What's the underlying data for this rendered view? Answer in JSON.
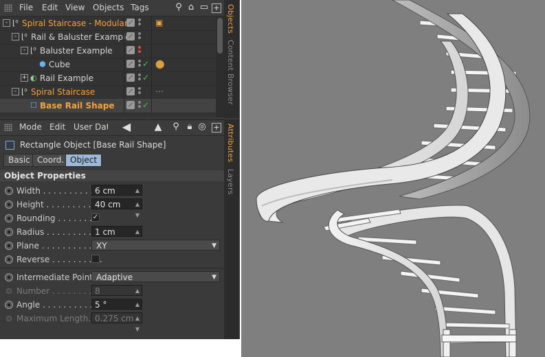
{
  "menu": [
    "File",
    "Edit",
    "View",
    "Objects",
    "Tags"
  ],
  "object_tree": [
    {
      "label": "Spiral Staircase - Modular",
      "color": "orange",
      "indent": 0,
      "expand": "-",
      "check": false
    },
    {
      "label": "Rail & Baluster Example",
      "color": "white",
      "indent": 1,
      "expand": "-",
      "check": false
    },
    {
      "label": "Baluster Example",
      "color": "white",
      "indent": 2,
      "expand": "-",
      "check": false
    },
    {
      "label": "Cube",
      "color": "white",
      "indent": 3,
      "expand": "",
      "check": true
    },
    {
      "label": "Rail Example",
      "color": "white",
      "indent": 2,
      "expand": "+",
      "check": true
    },
    {
      "label": "Spiral Staircase",
      "color": "orange",
      "indent": 1,
      "expand": "-",
      "check": false
    },
    {
      "label": "Base Rail Shape",
      "color": "orange",
      "indent": 2,
      "expand": "",
      "check": true,
      "selected": true
    }
  ],
  "side_tabs_top": [
    "Objects",
    "Content Browser"
  ],
  "side_tabs_bottom": [
    "Attributes",
    "Layers"
  ],
  "attr_menu": [
    "Mode",
    "Edit",
    "User Data"
  ],
  "attr_menu_visible": [
    "Mode",
    "Edit",
    "User Data"
  ],
  "attr_title": "Rectangle Object [Base Rail Shape]",
  "tabs": [
    "Basic",
    "Coord.",
    "Object"
  ],
  "section": "Object Properties",
  "props": [
    {
      "label": "Width . . . . . . . . . . .",
      "value": "6 cm",
      "type": "number"
    },
    {
      "label": "Height . . . . . . . . . . .",
      "value": "40 cm",
      "type": "number"
    },
    {
      "label": "Rounding . . . . . . . .",
      "value": "✓",
      "type": "checkbox"
    },
    {
      "label": "Radius . . . . . . . . . .",
      "value": "1 cm",
      "type": "number"
    },
    {
      "label": "Plane . . . . . . . . . . .",
      "value": "XY",
      "type": "dropdown"
    },
    {
      "label": "Reverse . . . . . . . . . .",
      "value": "",
      "type": "checkbox"
    }
  ],
  "props2": [
    {
      "label": "Intermediate Points",
      "value": "Adaptive",
      "type": "dropdown"
    },
    {
      "label": "Number . . . . . . . . .",
      "value": "8",
      "type": "number",
      "dim": true
    },
    {
      "label": "Angle . . . . . . . . . . .",
      "value": "5 °",
      "type": "number"
    },
    {
      "label": "Maximum Length. .",
      "value": "0.275 cm",
      "type": "number",
      "dim": true
    }
  ]
}
